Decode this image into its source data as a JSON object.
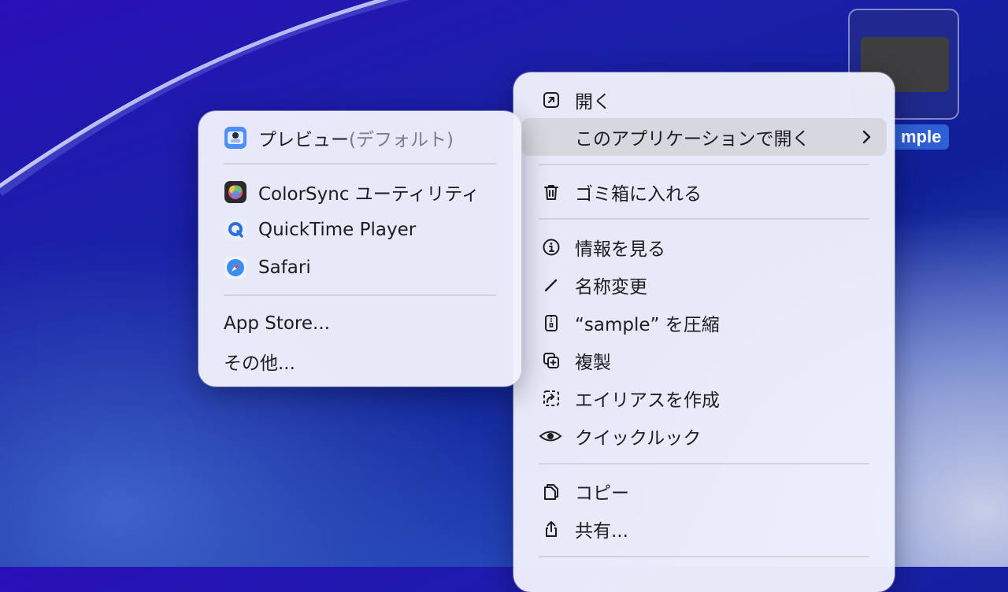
{
  "desktop": {
    "file_label": "mple"
  },
  "main_menu": {
    "open": "開く",
    "open_with": "このアプリケーションで開く",
    "trash": "ゴミ箱に入れる",
    "get_info": "情報を見る",
    "rename": "名称変更",
    "compress": "“sample” を圧縮",
    "duplicate": "複製",
    "make_alias": "エイリアスを作成",
    "quick_look": "クイックルック",
    "copy": "コピー",
    "share": "共有..."
  },
  "submenu": {
    "preview": "プレビュー",
    "preview_default": "(デフォルト)",
    "colorsync": "ColorSync ユーティリティ",
    "quicktime": "QuickTime Player",
    "safari": "Safari",
    "app_store": "App Store...",
    "other": "その他..."
  },
  "icons": {
    "open": "arrow-up-right-square-icon",
    "trash": "trash-icon",
    "info": "info-circle-icon",
    "rename": "pencil-icon",
    "compress": "zip-archive-icon",
    "duplicate": "duplicate-icon",
    "alias": "alias-icon",
    "quick_look": "eye-icon",
    "copy": "copy-docs-icon",
    "share": "share-icon",
    "chevron": "chevron-right-icon"
  },
  "colors": {
    "menu_bg": "#eef0fc",
    "highlight": "#d6d7df",
    "selection": "#2e5fd6"
  }
}
